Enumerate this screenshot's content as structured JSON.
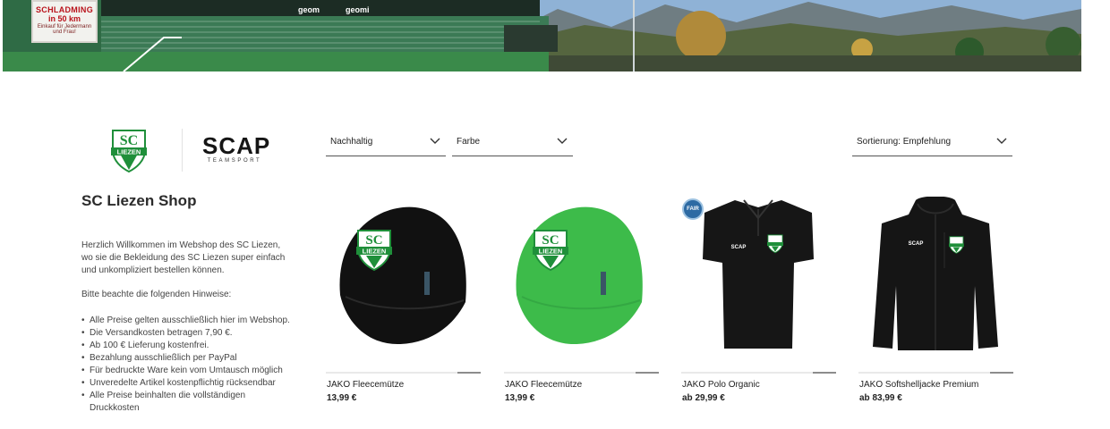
{
  "hero": {
    "sign_line1": "SCHLADMING",
    "sign_line2": "in 50 km",
    "sign_line3": "Einkauf für Jedermann und Frau!",
    "ad1": "geom",
    "ad2": "geomi"
  },
  "logos": {
    "club_text": "LIEZEN",
    "club_initials": "SC",
    "partner_main": "SCAP",
    "partner_sub": "TEAMSPORT"
  },
  "filters": {
    "sustainable": "Nachhaltig",
    "color": "Farbe",
    "sort": "Sortierung: Empfehlung"
  },
  "sidebar": {
    "title": "SC Liezen Shop",
    "intro": "Herzlich Willkommen im Webshop des SC Liezen, wo sie die Bekleidung des SC Liezen super einfach und unkompliziert bestellen können.",
    "notice_head": "Bitte beachte die folgenden Hinweise:",
    "bullets": [
      "Alle Preise gelten ausschließlich hier im Webshop.",
      "Die Versandkosten betragen 7,90 €.",
      "Ab 100 € Lieferung kostenfrei.",
      "Bezahlung ausschließlich per PayPal",
      "Für bedruckte Ware kein vom Umtausch möglich",
      "Unveredelte Artikel kostenpflichtig rücksendbar",
      "Alle Preise beinhalten die vollständigen Druckkosten"
    ]
  },
  "products": [
    {
      "name": "JAKO Fleecemütze",
      "price": "13,99 €",
      "color": "#111111"
    },
    {
      "name": "JAKO Fleecemütze",
      "price": "13,99 €",
      "color": "#3dbb4a"
    },
    {
      "name": "JAKO Polo Organic",
      "price": "ab 29,99 €",
      "color": "#161616",
      "badge": "FAIR"
    },
    {
      "name": "JAKO Softshelljacke Premium",
      "price": "ab 83,99 €",
      "color": "#151515"
    }
  ],
  "colors": {
    "club_green": "#1f8f3a",
    "text": "#222222"
  }
}
